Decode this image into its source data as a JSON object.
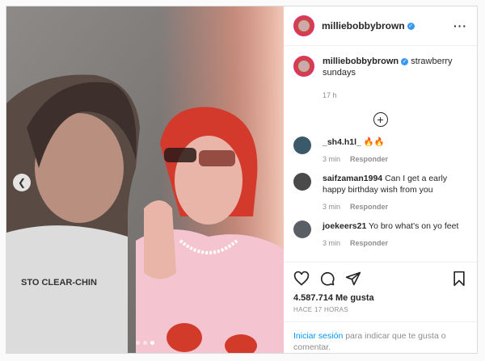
{
  "post": {
    "username": "milliebobbybrown",
    "verified": true,
    "caption": "strawberry sundays",
    "caption_time": "17 h",
    "more_icon": "more-options-icon",
    "colors": {
      "accent": "#0095f6",
      "verified": "#3897f0",
      "story_ring": "#e1306c"
    }
  },
  "media": {
    "carousel_dots": 3,
    "active_dot": 2,
    "photo_text": "STO CLEAR-CHIN"
  },
  "comments": [
    {
      "username": "_sh4.h1l_",
      "text": "🔥🔥",
      "time": "3 min",
      "reply": "Responder"
    },
    {
      "username": "saifzaman1994",
      "text": "Can I get a early happy birthday wish from you",
      "time": "3 min",
      "reply": "Responder"
    },
    {
      "username": "joekeers21",
      "text": "Yo bro what's on yo feet",
      "time": "3 min",
      "reply": "Responder"
    }
  ],
  "stats": {
    "likes": "4.587.714",
    "likes_label": "Me gusta",
    "posted": "HACE 17 HORAS"
  },
  "login": {
    "link": "Iniciar sesión",
    "text": "para indicar que te gusta o comentar."
  }
}
